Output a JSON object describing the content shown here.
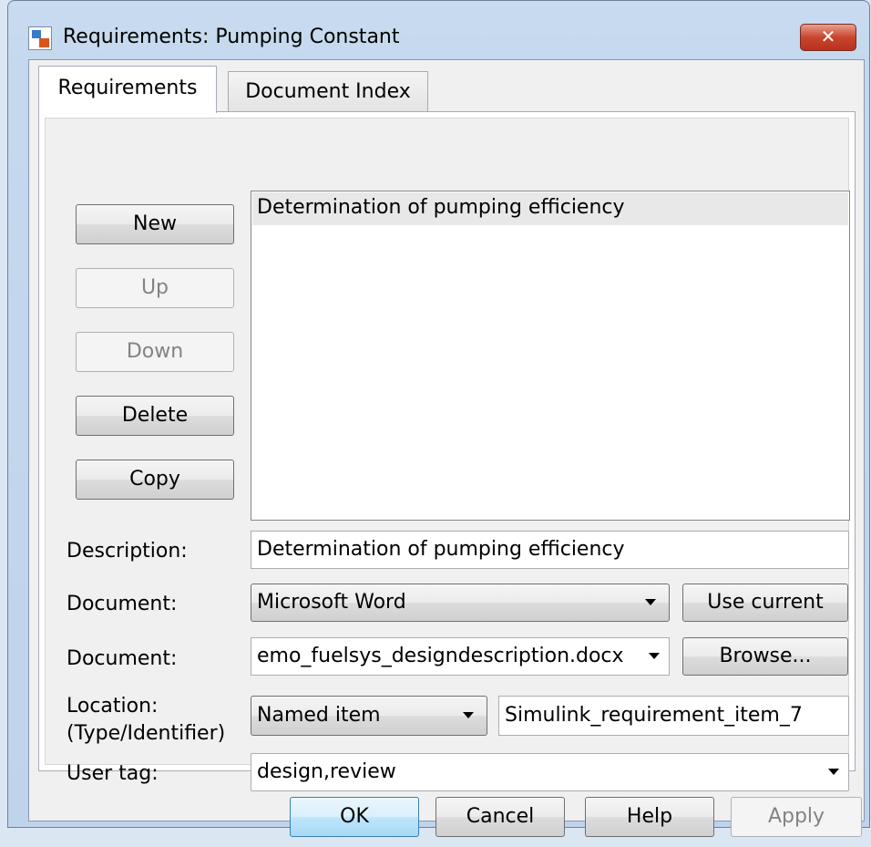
{
  "window": {
    "title": "Requirements: Pumping Constant",
    "close_glyph": "✕"
  },
  "tabs": [
    {
      "label": "Requirements",
      "active": true
    },
    {
      "label": "Document Index",
      "active": false
    }
  ],
  "side_buttons": {
    "new": "New",
    "up": "Up",
    "down": "Down",
    "delete": "Delete",
    "copy": "Copy"
  },
  "requirements_list": [
    "Determination of pumping efficiency"
  ],
  "form": {
    "description_label": "Description:",
    "description_value": "Determination of pumping efficiency",
    "doc_type_label": "Document:",
    "doc_type_value": "Microsoft Word",
    "use_current_label": "Use current",
    "document_label": "Document:",
    "document_value": "emo_fuelsys_designdescription.docx",
    "browse_label": "Browse...",
    "location_label_line1": "Location:",
    "location_label_line2": "(Type/Identifier)",
    "location_type_value": "Named item",
    "location_id_value": "Simulink_requirement_item_7",
    "user_tag_label": "User tag:",
    "user_tag_value": "design,review"
  },
  "footer": {
    "ok": "OK",
    "cancel": "Cancel",
    "help": "Help",
    "apply": "Apply"
  }
}
